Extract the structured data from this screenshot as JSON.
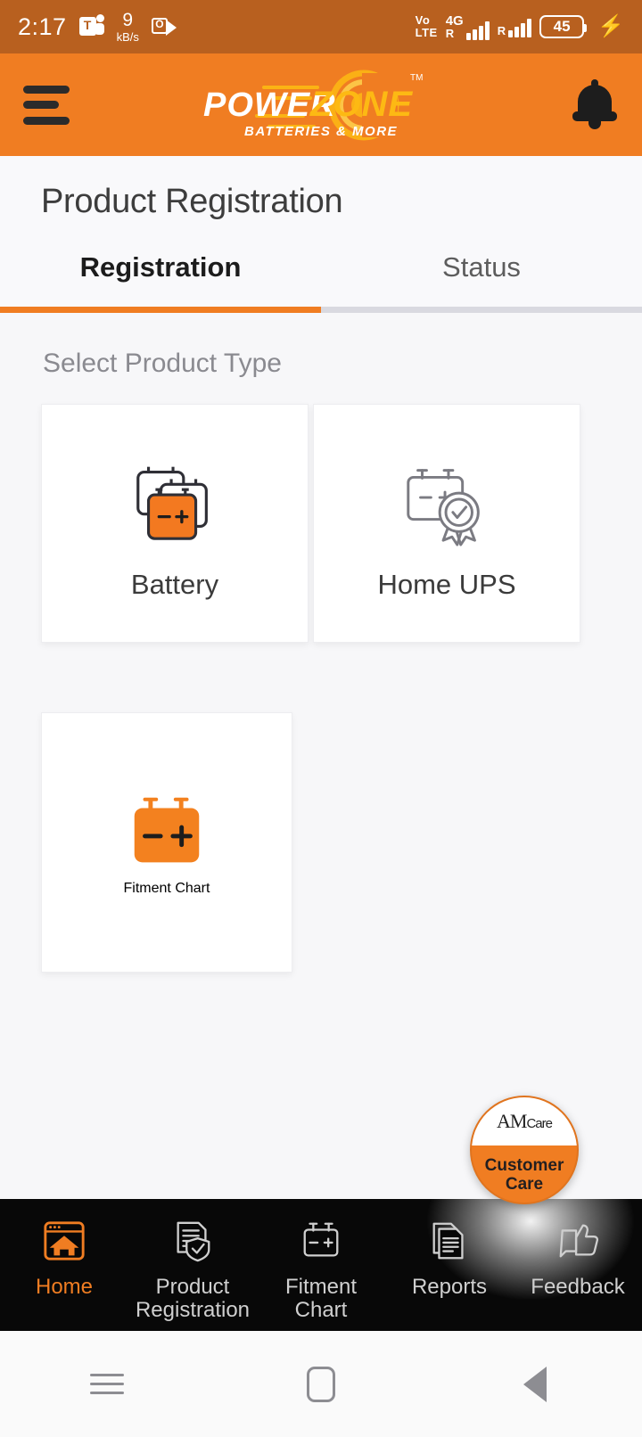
{
  "status_bar": {
    "time": "2:17",
    "teams_icon": "teams-icon",
    "network_speed_value": "9",
    "network_speed_unit": "kB/s",
    "outlook_icon": "outlook-icon",
    "volte_line1": "Vo",
    "volte_line2": "LTE",
    "network_type": "4G",
    "sim1_roaming": "R",
    "sim2_roaming": "R",
    "battery_level": "45",
    "charging_icon": "lightning-bolt-icon"
  },
  "app_bar": {
    "menu_icon": "hamburger-menu-icon",
    "logo_primary": "POWER",
    "logo_secondary": "ZONE",
    "logo_tagline": "BATTERIES & MORE",
    "logo_trademark": "TM",
    "notification_icon": "bell-icon"
  },
  "page": {
    "title": "Product Registration",
    "tabs": [
      {
        "label": "Registration",
        "active": true
      },
      {
        "label": "Status",
        "active": false
      }
    ],
    "section_label": "Select Product Type",
    "product_cards": [
      {
        "label": "Battery",
        "icon": "stacked-batteries-icon"
      },
      {
        "label": "Home UPS",
        "icon": "battery-certificate-icon"
      },
      {
        "label": "Fitment Chart",
        "icon": "orange-battery-icon"
      }
    ]
  },
  "fab": {
    "logo_a": "A",
    "logo_m": "M",
    "logo_care": "Care",
    "line1": "Customer",
    "line2": "Care"
  },
  "bottom_nav": [
    {
      "label": "Home",
      "icon": "home-window-icon",
      "active": true
    },
    {
      "label": "Product\nRegistration",
      "line1": "Product",
      "line2": "Registration",
      "icon": "document-shield-icon",
      "active": false
    },
    {
      "label": "Fitment\nChart",
      "line1": "Fitment",
      "line2": "Chart",
      "icon": "battery-outline-icon",
      "active": false
    },
    {
      "label": "Reports",
      "line1": "Reports",
      "line2": "",
      "icon": "report-document-icon",
      "active": false
    },
    {
      "label": "Feedback",
      "line1": "Feedback",
      "line2": "",
      "icon": "thumbs-up-icon",
      "active": false
    }
  ],
  "system_nav": {
    "recents_icon": "recents-icon",
    "home_icon": "home-square-icon",
    "back_icon": "back-triangle-icon"
  },
  "colors": {
    "brand_orange": "#f07d22",
    "status_bar": "#b8601f",
    "page_bg": "#f7f7f9",
    "nav_bg": "#080808",
    "logo_gold": "#fdb913"
  }
}
